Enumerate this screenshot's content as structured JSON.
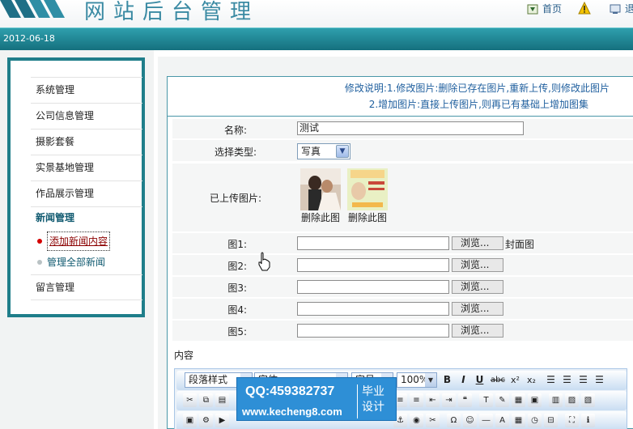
{
  "header": {
    "site_title": "网站后台管理",
    "links": [
      {
        "label": "首页",
        "icon": "home-icon"
      },
      {
        "label": "",
        "icon": "warning-icon"
      },
      {
        "label": "退",
        "icon": "exit-icon"
      }
    ],
    "date": "2012-06-18"
  },
  "sidebar": {
    "items": [
      {
        "label": "系统管理"
      },
      {
        "label": "公司信息管理"
      },
      {
        "label": "摄影套餐"
      },
      {
        "label": "实景基地管理"
      },
      {
        "label": "作品展示管理"
      }
    ],
    "active_section": "新闻管理",
    "sub_items": [
      {
        "label": "添加新闻内容"
      },
      {
        "label": "管理全部新闻"
      }
    ],
    "last_item": "留言管理"
  },
  "notes": {
    "line1": "修改说明:1.修改图片:删除已存在图片,重新上传,则修改此图片",
    "line2": "2.增加图片:直接上传图片,则再已有基础上增加图集"
  },
  "form": {
    "name_label": "名称:",
    "name_value": "测试",
    "type_label": "选择类型:",
    "type_value": "写真",
    "uploaded_label": "已上传图片:",
    "delete_label_1": "删除此图",
    "delete_label_2": "删除此图",
    "images": [
      {
        "label": "图1:",
        "browse": "浏览...",
        "note": "封面图"
      },
      {
        "label": "图2:",
        "browse": "浏览...",
        "note": ""
      },
      {
        "label": "图3:",
        "browse": "浏览...",
        "note": ""
      },
      {
        "label": "图4:",
        "browse": "浏览...",
        "note": ""
      },
      {
        "label": "图5:",
        "browse": "浏览...",
        "note": ""
      }
    ],
    "content_label": "内容"
  },
  "editor": {
    "paragraph_style": "段落样式",
    "font": "字体",
    "size": "字号",
    "zoom": "100%",
    "bold": "B",
    "italic": "I",
    "underline": "U",
    "strike": "abc",
    "superscript": "x²",
    "subscript": "x₂"
  },
  "watermark": {
    "qq": "QQ:459382737",
    "url": "www.kecheng8.com",
    "tag_line1": "毕业",
    "tag_line2": "设计"
  },
  "colors": {
    "accent": "#1f7e8a",
    "date_bar": "#15707e",
    "note_text": "#1f5f9e",
    "badge": "#2e8fd6"
  }
}
